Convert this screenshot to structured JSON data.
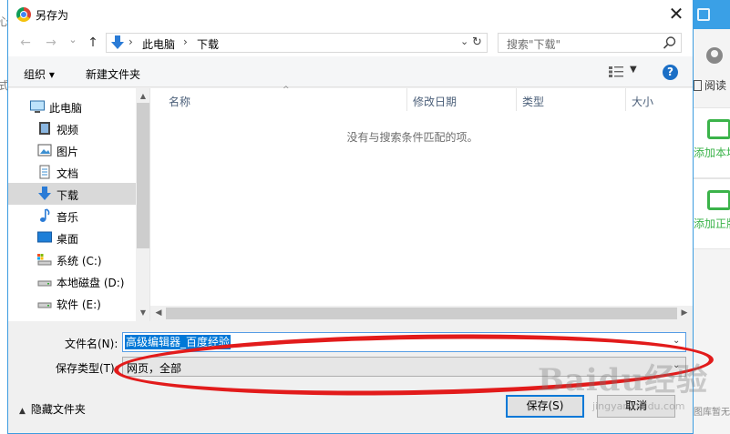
{
  "window": {
    "title": "另存为",
    "close": "✕"
  },
  "nav": {
    "back": "←",
    "forward": "→",
    "recent": "⌄",
    "up": "↑",
    "breadcrumb": [
      "此电脑",
      "下载"
    ],
    "breadcrumb_sep": "›",
    "refresh": "↻",
    "search_placeholder": "搜索\"下载\""
  },
  "toolbar": {
    "organize": "组织 ▾",
    "new_folder": "新建文件夹",
    "help": "?"
  },
  "tree": [
    {
      "label": "此电脑",
      "icon": "pc-icon",
      "selected": false
    },
    {
      "label": "视频",
      "icon": "video-icon",
      "selected": false
    },
    {
      "label": "图片",
      "icon": "pictures-icon",
      "selected": false
    },
    {
      "label": "文档",
      "icon": "documents-icon",
      "selected": false
    },
    {
      "label": "下载",
      "icon": "download-icon",
      "selected": true
    },
    {
      "label": "音乐",
      "icon": "music-icon",
      "selected": false
    },
    {
      "label": "桌面",
      "icon": "desktop-icon",
      "selected": false
    },
    {
      "label": "系统 (C:)",
      "icon": "drive-c-icon",
      "selected": false
    },
    {
      "label": "本地磁盘 (D:)",
      "icon": "drive-d-icon",
      "selected": false
    },
    {
      "label": "软件 (E:)",
      "icon": "drive-e-icon",
      "selected": false
    }
  ],
  "columns": [
    "名称",
    "修改日期",
    "类型",
    "大小"
  ],
  "empty_message": "没有与搜索条件匹配的项。",
  "form": {
    "filename_label": "文件名(N):",
    "filename_value": "高级编辑器_百度经验",
    "type_label": "保存类型(T):",
    "type_value": "网页，全部"
  },
  "footer": {
    "hide_folders": "隐藏文件夹",
    "save": "保存(S)",
    "cancel": "取消"
  },
  "background_app": {
    "read": "阅读",
    "add_local": "添加本地",
    "add_genuine": "添加正版",
    "footer": "图库暂无"
  },
  "watermark": {
    "text": "Baidu经验",
    "sub": "jingyan.baidu.com"
  },
  "colors": {
    "accent": "#0078d7",
    "annotation": "#e21b1b",
    "bg_app_green": "#3bb34a"
  }
}
